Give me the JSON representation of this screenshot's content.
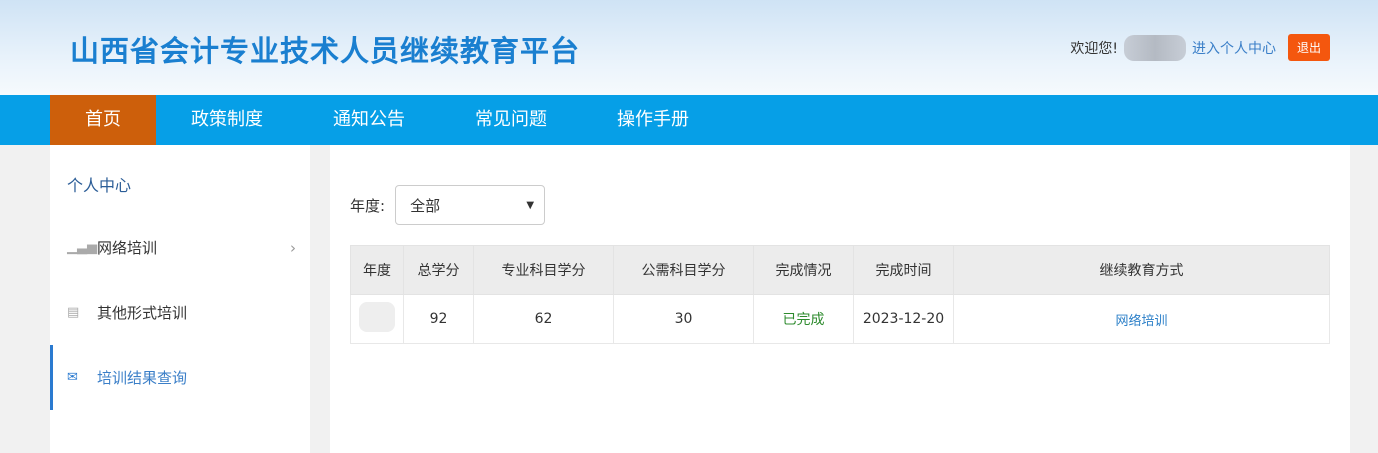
{
  "header": {
    "title": "山西省会计专业技术人员继续教育平台",
    "welcome": "欢迎您!",
    "personal_center": "进入个人中心",
    "logout": "退出"
  },
  "nav": [
    "首页",
    "政策制度",
    "通知公告",
    "常见问题",
    "操作手册"
  ],
  "sidebar": {
    "title": "个人中心",
    "items": [
      {
        "label": "网络培训"
      },
      {
        "label": "其他形式培训"
      },
      {
        "label": "培训结果查询"
      }
    ]
  },
  "filter": {
    "label": "年度:",
    "value": "全部"
  },
  "table": {
    "headers": [
      "年度",
      "总学分",
      "专业科目学分",
      "公需科目学分",
      "完成情况",
      "完成时间",
      "继续教育方式"
    ],
    "rows": [
      {
        "total": "92",
        "professional": "62",
        "public": "30",
        "status": "已完成",
        "date": "2023-12-20",
        "method": "网络培训"
      }
    ]
  }
}
